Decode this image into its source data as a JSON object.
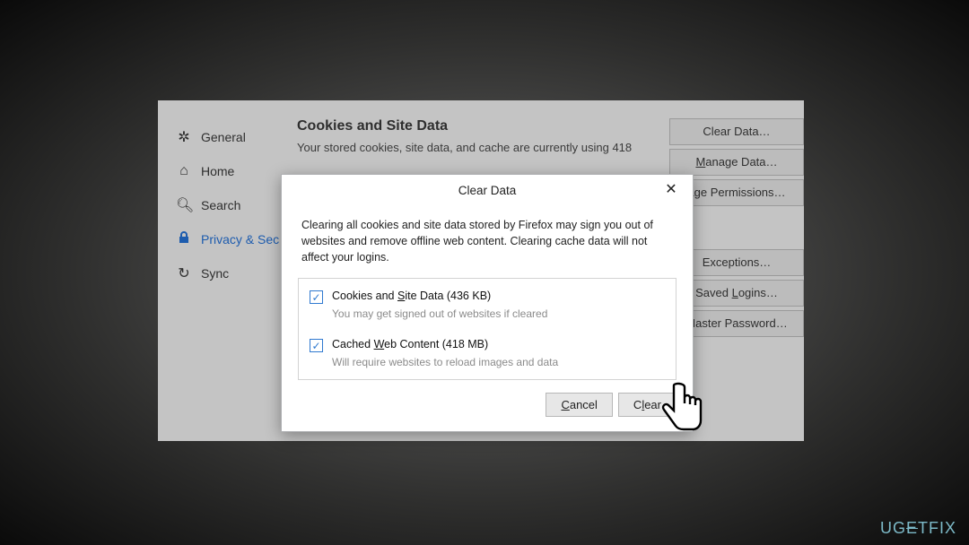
{
  "sidebar": {
    "items": [
      {
        "label": "General"
      },
      {
        "label": "Home"
      },
      {
        "label": "Search"
      },
      {
        "label": "Privacy & Sec"
      },
      {
        "label": "Sync"
      }
    ]
  },
  "section": {
    "title": "Cookies and Site Data",
    "desc": "Your stored cookies, site data, and cache are currently using 418"
  },
  "side_buttons": {
    "clear_data": "Clear Data…",
    "manage_data": "Manage Data…",
    "manage_permissions": "age Permissions…",
    "exceptions": "Exceptions…",
    "saved_logins": "Saved Logins…",
    "master_password": "Master Password…"
  },
  "dialog": {
    "title": "Clear Data",
    "message": "Clearing all cookies and site data stored by Firefox may sign you out of websites and remove offline web content. Clearing cache data will not affect your logins.",
    "opt1_label": "Cookies and Site Data (436 KB)",
    "opt1_sub": "You may get signed out of websites if cleared",
    "opt2_label": "Cached Web Content (418 MB)",
    "opt2_sub": "Will require websites to reload images and data",
    "cancel": "Cancel",
    "clear": "Clear"
  },
  "watermark": "UGETFIX"
}
